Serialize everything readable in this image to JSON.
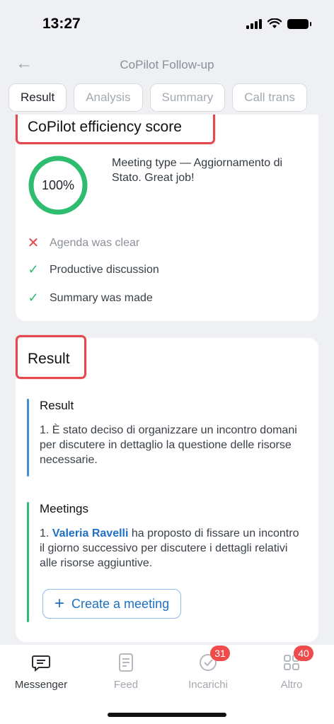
{
  "status_bar": {
    "time": "13:27"
  },
  "header": {
    "back_icon": "arrow-left-icon",
    "title": "CoPilot Follow-up"
  },
  "tabs": [
    {
      "label": "Result",
      "active": true
    },
    {
      "label": "Analysis",
      "active": false
    },
    {
      "label": "Summary",
      "active": false
    },
    {
      "label": "Call trans",
      "active": false
    }
  ],
  "score_card": {
    "title": "CoPilot efficiency score",
    "score": "100%",
    "score_fraction": 1.0,
    "ring_color": "#2ebc6f",
    "meeting_text": "Meeting type — Aggiornamento di Stato. Great job!",
    "criteria": [
      {
        "icon": "x-icon",
        "symbol": "✕",
        "label": "Agenda was clear",
        "passed": false
      },
      {
        "icon": "check-icon",
        "symbol": "✓",
        "label": "Productive discussion",
        "passed": true
      },
      {
        "icon": "check-icon",
        "symbol": "✓",
        "label": "Summary was made",
        "passed": true
      }
    ]
  },
  "result_card": {
    "title": "Result",
    "result_section": {
      "title": "Result",
      "text": "1. È stato deciso di organizzare un incontro domani per discutere in dettaglio la questione delle risorse necessarie."
    },
    "meetings_section": {
      "title": "Meetings",
      "prefix": "1. ",
      "person": "Valeria Ravelli",
      "text": " ha proposto di fissare un incontro il giorno successivo per discutere i dettagli relativi alle risorse aggiuntive."
    },
    "create_button": {
      "symbol": "+",
      "label": "Create a meeting"
    }
  },
  "tabbar": {
    "items": [
      {
        "label": "Messenger",
        "icon": "chat-icon",
        "badge": "",
        "active": true
      },
      {
        "label": "Feed",
        "icon": "feed-icon",
        "badge": "",
        "active": false
      },
      {
        "label": "Incarichi",
        "icon": "check-circle-icon",
        "badge": "31",
        "active": false
      },
      {
        "label": "Altro",
        "icon": "grid-icon",
        "badge": "40",
        "active": false
      }
    ]
  },
  "colors": {
    "accent": "#1f6fc4",
    "success": "#2ebc6f",
    "danger": "#e5484d",
    "badge": "#ef4b4b"
  }
}
